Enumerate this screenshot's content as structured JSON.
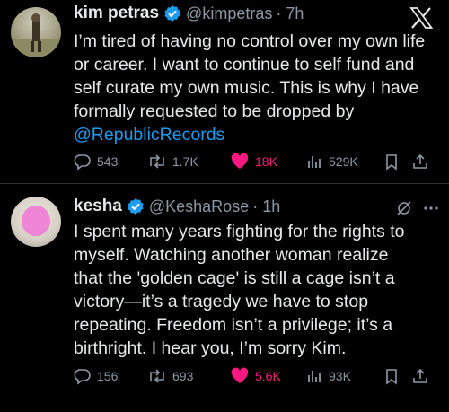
{
  "tweets": [
    {
      "name": "kim petras",
      "handle": "@kimpetras",
      "time": "· 7h",
      "text_lines": [
        "I’m tired of having no control over my own life",
        "or career. I want to continue to self fund and",
        "self curate my own music. This is why I have",
        "formally requested to be dropped by"
      ],
      "mention": "@RepublicRecords",
      "replies": "543",
      "reposts": "1.7K",
      "likes": "18K",
      "views": "529K"
    },
    {
      "name": "kesha",
      "handle": "@KeshaRose",
      "time": "· 1h",
      "text_lines": [
        "I spent many years fighting for the rights to",
        "myself. Watching another woman realize",
        "that the 'golden cage' is still a cage isn’t a",
        "victory—it’s a tragedy we have to stop",
        "repeating. Freedom isn’t a privilege; it’s a",
        "birthright. I hear you, I’m sorry Kim."
      ],
      "replies": "156",
      "reposts": "693",
      "likes": "5.6K",
      "views": "93K"
    }
  ],
  "colors": {
    "background": "#000000",
    "text": "#e7e9ea",
    "muted": "#8b98a5",
    "link": "#1d9bf0",
    "like": "#f91880",
    "verified": "#1d9bf0"
  },
  "icons": [
    "x-logo-icon",
    "verified-badge-icon",
    "reply-icon",
    "repost-icon",
    "heart-icon",
    "views-icon",
    "bookmark-icon",
    "share-icon",
    "grok-icon",
    "more-icon"
  ]
}
